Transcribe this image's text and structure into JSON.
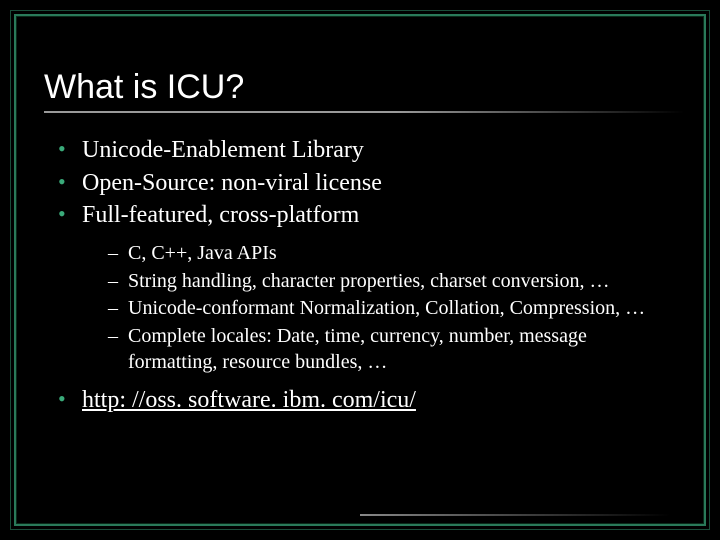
{
  "slide": {
    "title": "What is ICU?",
    "bullets": {
      "b0": "Unicode-Enablement Library",
      "b1": "Open-Source: non-viral license",
      "b2": "Full-featured, cross-platform",
      "sub": {
        "s0": "C, C++, Java APIs",
        "s1": "String handling, character properties, charset conversion, …",
        "s2": "Unicode-conformant Normalization, Collation, Compression, …",
        "s3": "Complete locales: Date, time, currency, number, message formatting, resource bundles, …"
      },
      "b3_link": "http: //oss. software. ibm. com/icu/"
    }
  }
}
